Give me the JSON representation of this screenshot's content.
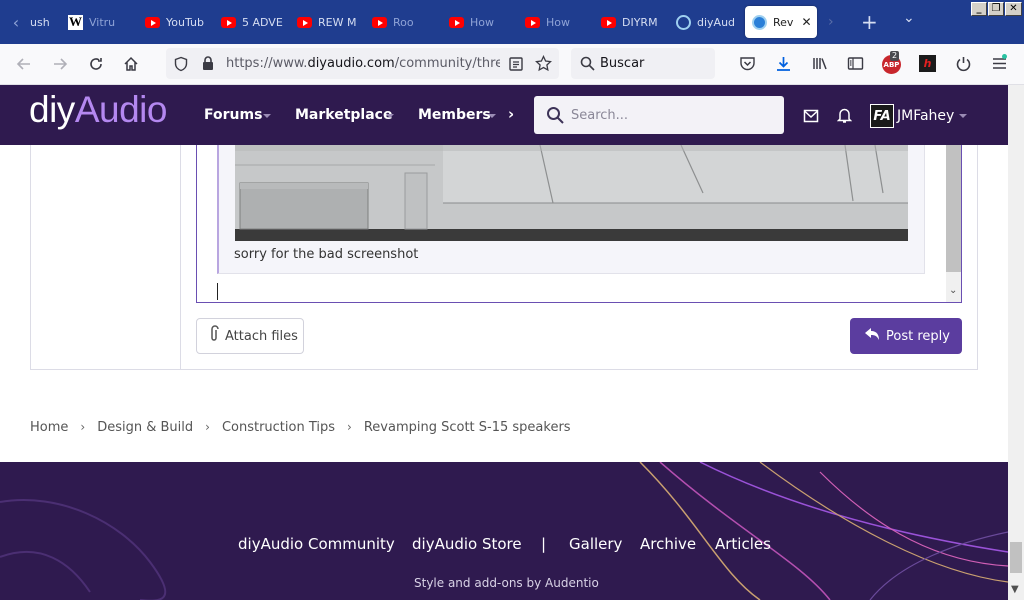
{
  "browser": {
    "tabs": [
      {
        "label": "ush",
        "icon": "none"
      },
      {
        "label": "Vitru",
        "icon": "wikipedia-icon"
      },
      {
        "label": "YouTub",
        "icon": "youtube-icon"
      },
      {
        "label": "5 ADVE",
        "icon": "youtube-icon"
      },
      {
        "label": "REW M",
        "icon": "youtube-icon"
      },
      {
        "label": "Roo",
        "icon": "youtube-icon"
      },
      {
        "label": "How",
        "icon": "youtube-icon"
      },
      {
        "label": "How",
        "icon": "youtube-icon"
      },
      {
        "label": "DIYRM",
        "icon": "youtube-icon"
      },
      {
        "label": "diyAud",
        "icon": "diyaudio-icon"
      },
      {
        "label": "Rev",
        "icon": "diyaudio-icon",
        "active": true
      }
    ],
    "url": {
      "prefix": "https://www.",
      "domain": "diyaudio.com",
      "path": "/community/threads/"
    },
    "search_placeholder": "Buscar",
    "abp_badge": "2"
  },
  "site": {
    "logo_diy": "diy",
    "logo_audio": "Audio",
    "nav": [
      "Forums",
      "Marketplace",
      "Members"
    ],
    "search_placeholder": "Search...",
    "user": {
      "initials": "FA",
      "name": "JMFahey"
    },
    "brand_color": "#2f1a4f",
    "accent_color": "#5b3d9f"
  },
  "editor": {
    "quote_caption": "sorry for the bad screenshot",
    "attach_label": "Attach files",
    "post_label": "Post reply"
  },
  "breadcrumb": [
    "Home",
    "Design & Build",
    "Construction Tips",
    "Revamping Scott S-15 speakers"
  ],
  "footer": {
    "links": [
      "diyAudio Community",
      "diyAudio Store",
      "|",
      "Gallery",
      "Archive",
      "Articles"
    ],
    "credit": "Style and add-ons by Audentio"
  }
}
